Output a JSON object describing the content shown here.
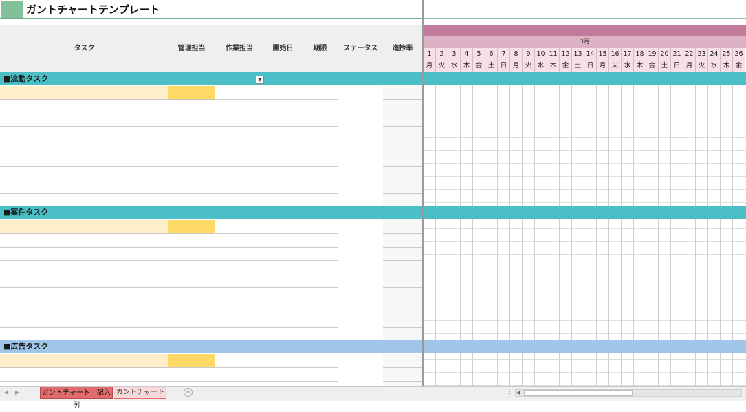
{
  "title": "ガントチャートテンプレート",
  "headers": {
    "task": "タスク",
    "manager": "管理担当",
    "worker": "作業担当",
    "start": "開始日",
    "deadline": "期限",
    "status": "ステータス",
    "progress": "進捗率"
  },
  "gantt": {
    "month": "3月",
    "days": [
      "1",
      "2",
      "3",
      "4",
      "5",
      "6",
      "7",
      "8",
      "9",
      "10",
      "11",
      "12",
      "13",
      "14",
      "15",
      "16",
      "17",
      "18",
      "19",
      "20",
      "21",
      "22",
      "23",
      "24",
      "25",
      "26"
    ],
    "weekdays": [
      "月",
      "火",
      "水",
      "木",
      "金",
      "土",
      "日",
      "月",
      "火",
      "水",
      "木",
      "金",
      "土",
      "日",
      "月",
      "火",
      "水",
      "木",
      "金",
      "土",
      "日",
      "月",
      "火",
      "水",
      "木",
      "金"
    ]
  },
  "sections": [
    {
      "label": "■流動タスク",
      "color": "#4bbec6"
    },
    {
      "label": "■案件タスク",
      "color": "#4bbec6"
    },
    {
      "label": "■広告タスク",
      "color": "#9fc5e8"
    }
  ],
  "dropdown": {
    "icon": "chevron-down-icon"
  },
  "tabs": {
    "example": "ガントチャート　記入例",
    "template": "ガントチャート",
    "add": "+"
  },
  "colors": {
    "title_swatch": "#82c09a",
    "gantt_header": "#c07a9c",
    "month_band": "#ddb1c3",
    "day_cells": "#f7dfe8",
    "highlight_yellow": "#ffd966",
    "highlight_cream": "#fff0c9",
    "active_tab": "#e26b6b"
  }
}
